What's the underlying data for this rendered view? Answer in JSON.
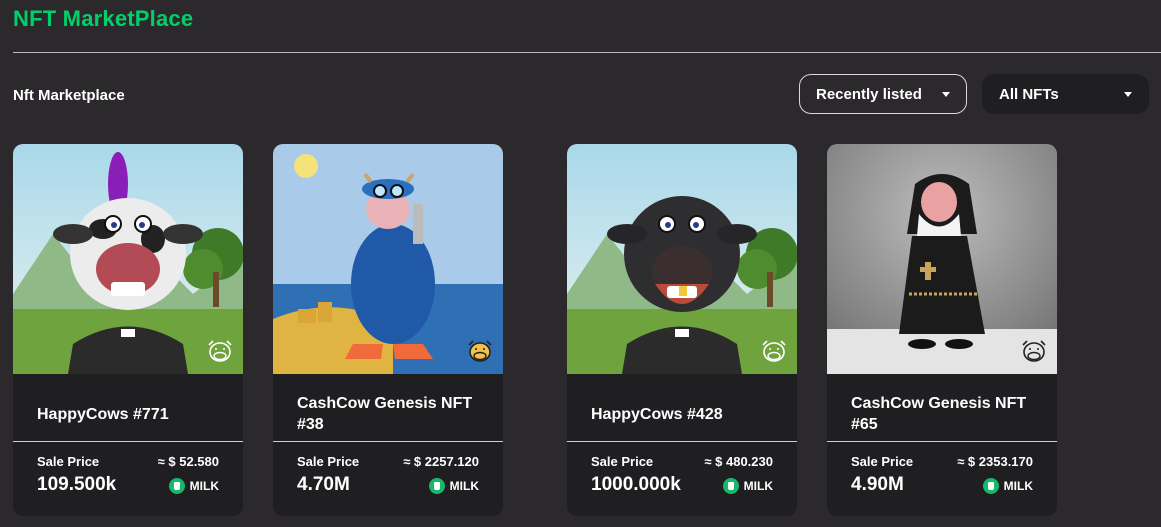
{
  "header": {
    "title": "NFT MarketPlace"
  },
  "toolbar": {
    "section_label": "Nft Marketplace",
    "sort_selected": "Recently listed",
    "filter_selected": "All NFTs"
  },
  "colors": {
    "accent": "#00d06a",
    "background": "#2b292b",
    "card": "#1f1e21",
    "token": "#16b86a"
  },
  "cards": [
    {
      "name": "HappyCows #771",
      "sale_label": "Sale Price",
      "usd": "≈ $ 52.580",
      "price": "109.500k",
      "token": "MILK",
      "image": "zebra-punk-cow"
    },
    {
      "name": "CashCow Genesis NFT #38",
      "sale_label": "Sale Price",
      "usd": "≈ $ 2257.120",
      "price": "4.70M",
      "token": "MILK",
      "image": "diver-cow"
    },
    {
      "name": "HappyCows #428",
      "sale_label": "Sale Price",
      "usd": "≈ $ 480.230",
      "price": "1000.000k",
      "token": "MILK",
      "image": "black-cow-gold-tooth"
    },
    {
      "name": "CashCow Genesis NFT #65",
      "sale_label": "Sale Price",
      "usd": "≈ $ 2353.170",
      "price": "4.90M",
      "token": "MILK",
      "image": "nun-cow"
    }
  ]
}
